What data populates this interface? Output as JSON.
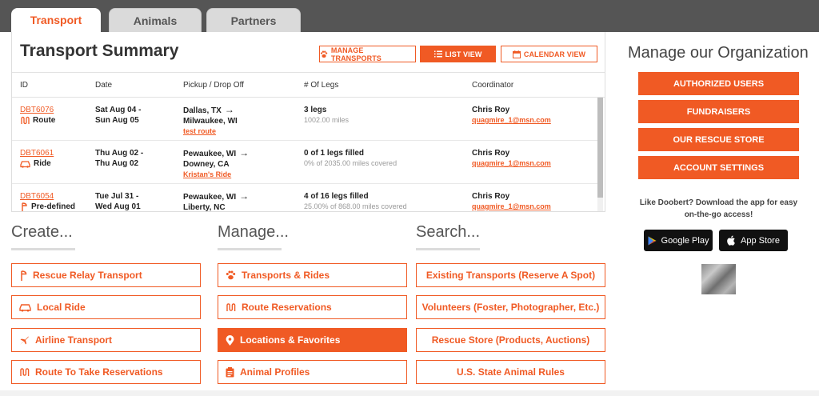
{
  "tabs": [
    {
      "label": "Transport"
    },
    {
      "label": "Animals"
    },
    {
      "label": "Partners"
    }
  ],
  "summary": {
    "title": "Transport Summary",
    "buttons": {
      "manage": "MANAGE TRANSPORTS",
      "list": "LIST VIEW",
      "calendar": "CALENDAR VIEW"
    },
    "columns": [
      "ID",
      "Date",
      "Pickup / Drop Off",
      "# Of Legs",
      "Coordinator"
    ],
    "rows": [
      {
        "id": "DBT6076",
        "type": "Route",
        "icon": "route-icon",
        "date_start": "Sat Aug 04 -",
        "date_end": "Sun Aug 05",
        "pickup": "Dallas, TX",
        "dropoff": "Milwaukee, WI",
        "name": "test route",
        "legs": "3 legs",
        "miles": "1002.00 miles",
        "coordinator": "Chris Roy",
        "email": "quagmire_1@msn.com"
      },
      {
        "id": "DBT6061",
        "type": "Ride",
        "icon": "car-icon",
        "date_start": "Thu Aug 02 -",
        "date_end": "Thu Aug 02",
        "pickup": "Pewaukee, WI",
        "dropoff": "Downey, CA",
        "name": "Kristan's Ride",
        "legs": "0 of 1 legs filled",
        "miles": "0% of 2035.00 miles covered",
        "coordinator": "Chris Roy",
        "email": "quagmire_1@msn.com"
      },
      {
        "id": "DBT6054",
        "type": "Pre-defined",
        "icon": "relay-icon",
        "date_start": "Tue Jul 31 -",
        "date_end": "Wed Aug 01",
        "pickup": "Pewaukee, WI",
        "dropoff": "Liberty, NC",
        "name": "",
        "legs": "4 of 16 legs filled",
        "miles": "25.00% of 868.00 miles covered",
        "coordinator": "Chris Roy",
        "email": "quagmire_1@msn.com"
      }
    ]
  },
  "create": {
    "heading": "Create...",
    "items": [
      "Rescue Relay Transport",
      "Local Ride",
      "Airline Transport",
      "Route To Take Reservations"
    ]
  },
  "manage": {
    "heading": "Manage...",
    "items": [
      "Transports & Rides",
      "Route Reservations",
      "Locations & Favorites",
      "Animal Profiles"
    ]
  },
  "search": {
    "heading": "Search...",
    "items": [
      "Existing Transports (Reserve A Spot)",
      "Volunteers (Foster, Photographer, Etc.)",
      "Rescue Store (Products, Auctions)",
      "U.S. State Animal Rules"
    ]
  },
  "organization": {
    "title": "Manage our Organization",
    "buttons": [
      "AUTHORIZED USERS",
      "FUNDRAISERS",
      "OUR RESCUE STORE",
      "ACCOUNT SETTINGS"
    ],
    "promo": "Like Doobert? Download the app for easy on-the-go access!",
    "google_play": "Google Play",
    "app_store": "App Store"
  },
  "colors": {
    "accent": "#f05a24",
    "topbar": "#555555"
  }
}
